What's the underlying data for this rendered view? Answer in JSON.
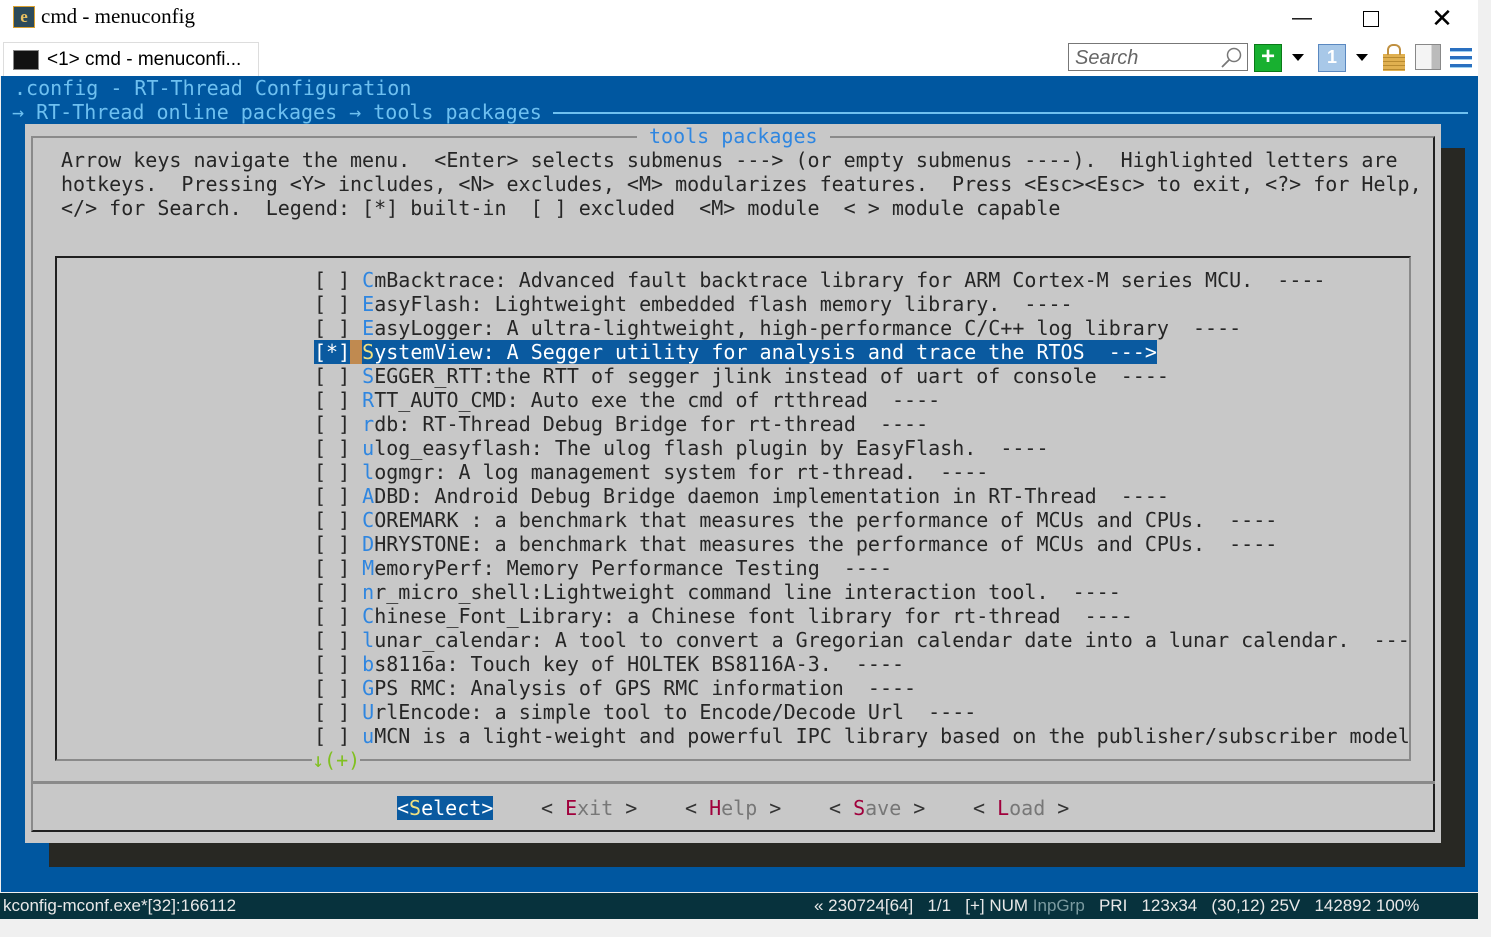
{
  "window": {
    "title": "cmd - menuconfig",
    "tab_label": "<1> cmd - menuconfi...",
    "search_placeholder": "Search"
  },
  "toolbar": {
    "icons": [
      "search-icon",
      "new-console-icon",
      "dropdown-icon",
      "console-number-icon",
      "dropdown-icon",
      "lock-icon",
      "panel-icon",
      "menu-icon"
    ]
  },
  "colors": {
    "terminal_bg": "#0057a0",
    "dialog_bg": "#c8c8c8",
    "hotkey": "#2f86e0",
    "button_hotkey": "#a0003c",
    "selection": "#0a5aa0",
    "status_bg": "#07323d"
  },
  "header": {
    "config_line": ".config - RT-Thread Configuration",
    "breadcrumb": "→ RT-Thread online packages → tools packages"
  },
  "dialog": {
    "title": "tools packages",
    "help": [
      "Arrow keys navigate the menu.  <Enter> selects submenus ---> (or empty submenus ----).  Highlighted letters are",
      "hotkeys.  Pressing <Y> includes, <N> excludes, <M> modularizes features.  Press <Esc><Esc> to exit, <?> for Help,",
      "</> for Search.  Legend: [*] built-in  [ ] excluded  <M> module  < > module capable"
    ],
    "more_indicator": "↓(+)"
  },
  "items": [
    {
      "check": "[ ]",
      "hotkey": "C",
      "rest": "mBacktrace: Advanced fault backtrace library for ARM Cortex-M series MCU.  ----"
    },
    {
      "check": "[ ]",
      "hotkey": "E",
      "rest": "asyFlash: Lightweight embedded flash memory library.  ----"
    },
    {
      "check": "[ ]",
      "hotkey": "E",
      "rest": "asyLogger: A ultra-lightweight, high-performance C/C++ log library  ----"
    },
    {
      "check": "[*]",
      "hotkey": "S",
      "rest": "ystemView: A Segger utility for analysis and trace the RTOS  --->",
      "selected": true
    },
    {
      "check": "[ ]",
      "hotkey": "S",
      "rest": "EGGER_RTT:the RTT of segger jlink instead of uart of console  ----"
    },
    {
      "check": "[ ]",
      "hotkey": "R",
      "rest": "TT_AUTO_CMD: Auto exe the cmd of rtthread  ----"
    },
    {
      "check": "[ ]",
      "hotkey": "r",
      "rest": "db: RT-Thread Debug Bridge for rt-thread  ----"
    },
    {
      "check": "[ ]",
      "hotkey": "u",
      "rest": "log_easyflash: The ulog flash plugin by EasyFlash.  ----"
    },
    {
      "check": "[ ]",
      "hotkey": "l",
      "rest": "ogmgr: A log management system for rt-thread.  ----"
    },
    {
      "check": "[ ]",
      "hotkey": "A",
      "rest": "DBD: Android Debug Bridge daemon implementation in RT-Thread  ----"
    },
    {
      "check": "[ ]",
      "hotkey": "C",
      "rest": "OREMARK : a benchmark that measures the performance of MCUs and CPUs.  ----"
    },
    {
      "check": "[ ]",
      "hotkey": "D",
      "rest": "HRYSTONE: a benchmark that measures the performance of MCUs and CPUs.  ----"
    },
    {
      "check": "[ ]",
      "hotkey": "M",
      "rest": "emoryPerf: Memory Performance Testing  ----"
    },
    {
      "check": "[ ]",
      "hotkey": "n",
      "rest": "r_micro_shell:Lightweight command line interaction tool.  ----"
    },
    {
      "check": "[ ]",
      "hotkey": "C",
      "rest": "hinese_Font_Library: a Chinese font library for rt-thread  ----"
    },
    {
      "check": "[ ]",
      "hotkey": "l",
      "rest": "unar_calendar: A tool to convert a Gregorian calendar date into a lunar calendar.  ---"
    },
    {
      "check": "[ ]",
      "hotkey": "b",
      "rest": "s8116a: Touch key of HOLTEK BS8116A-3.  ----"
    },
    {
      "check": "[ ]",
      "hotkey": "G",
      "rest": "PS RMC: Analysis of GPS RMC information  ----"
    },
    {
      "check": "[ ]",
      "hotkey": "U",
      "rest": "rlEncode: a simple tool to Encode/Decode Url  ----"
    },
    {
      "check": "[ ]",
      "hotkey": "u",
      "rest": "MCN is a light-weight and powerful IPC library based on the publisher/subscriber model"
    }
  ],
  "buttons": [
    {
      "pre": "<",
      "hotkey": "S",
      "rest": "elect",
      "post": ">",
      "active": true
    },
    {
      "pre": "< ",
      "hotkey": "E",
      "rest": "xit",
      "post": " >"
    },
    {
      "pre": "< ",
      "hotkey": "H",
      "rest": "elp",
      "post": " >"
    },
    {
      "pre": "< ",
      "hotkey": "S",
      "rest": "ave",
      "post": " >"
    },
    {
      "pre": "< ",
      "hotkey": "L",
      "rest": "oad",
      "post": " >"
    }
  ],
  "status": {
    "left": "kconfig-mconf.exe*[32]:166112",
    "pos": "« 230724[64]",
    "page": "1/1",
    "flags": "[+] NUM",
    "inpgrp": "InpGrp",
    "pri": "PRI",
    "size": "123x34",
    "cursor": "(30,12) 25V",
    "extra": "142892 100%"
  }
}
